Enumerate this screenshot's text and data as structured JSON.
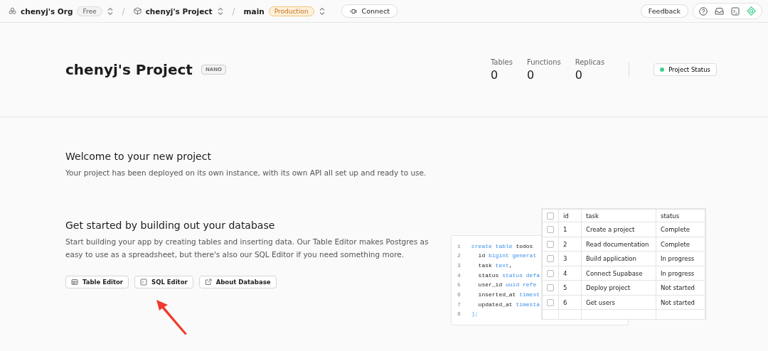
{
  "topbar": {
    "breadcrumbs": [
      {
        "kind": "org",
        "label": "chenyj's Org",
        "badge": {
          "text": "Free",
          "kind": "plan"
        }
      },
      {
        "kind": "project",
        "separator": "/",
        "label": "chenyj's Project"
      },
      {
        "kind": "branch",
        "separator": "/",
        "label": "main",
        "badge": {
          "text": "Production",
          "kind": "environment"
        }
      }
    ],
    "connect": "Connect",
    "feedback": "Feedback"
  },
  "header": {
    "title": "chenyj's Project",
    "tier": "NANO",
    "stats": [
      {
        "label": "Tables",
        "value": "0"
      },
      {
        "label": "Functions",
        "value": "0"
      },
      {
        "label": "Replicas",
        "value": "0"
      }
    ],
    "status": "Project Status"
  },
  "welcome": {
    "title": "Welcome to your new project",
    "text": "Your project has been deployed on its own instance, with its own API all set up and ready to use."
  },
  "database": {
    "title": "Get started by building out your database",
    "text": "Start building your app by creating tables and inserting data. Our Table Editor makes Postgres as easy to use as a spreadsheet, but there's also our SQL Editor if you need something more.",
    "buttons": [
      {
        "kind": "table",
        "label": "Table Editor"
      },
      {
        "kind": "sql",
        "label": "SQL Editor"
      },
      {
        "kind": "external",
        "label": "About Database"
      }
    ],
    "code": [
      {
        "number": "1",
        "indented": false,
        "tokens": [
          {
            "kind": "keyword",
            "text": "create table"
          },
          {
            "kind": "plain",
            "text": " todos"
          }
        ]
      },
      {
        "number": "2",
        "indented": true,
        "tokens": [
          {
            "kind": "plain",
            "text": "id "
          },
          {
            "kind": "keyword",
            "text": "bigint generat"
          }
        ]
      },
      {
        "number": "3",
        "indented": true,
        "tokens": [
          {
            "kind": "plain",
            "text": "task "
          },
          {
            "kind": "keyword",
            "text": "text"
          },
          {
            "kind": "plain",
            "text": ","
          }
        ]
      },
      {
        "number": "4",
        "indented": true,
        "tokens": [
          {
            "kind": "plain",
            "text": "status "
          },
          {
            "kind": "keyword",
            "text": "status defa"
          }
        ]
      },
      {
        "number": "5",
        "indented": true,
        "tokens": [
          {
            "kind": "plain",
            "text": "user_id "
          },
          {
            "kind": "keyword",
            "text": "uuid refe"
          }
        ]
      },
      {
        "number": "6",
        "indented": true,
        "tokens": [
          {
            "kind": "plain",
            "text": "inserted_at "
          },
          {
            "kind": "keyword",
            "text": "timest"
          }
        ]
      },
      {
        "number": "7",
        "indented": true,
        "tokens": [
          {
            "kind": "plain",
            "text": "updated_at "
          },
          {
            "kind": "keyword",
            "text": "timesta"
          }
        ]
      },
      {
        "number": "8",
        "indented": false,
        "tokens": [
          {
            "kind": "keyword",
            "text": ");"
          }
        ]
      }
    ],
    "table": {
      "columns": [
        "id",
        "task",
        "status"
      ],
      "header_checked": false,
      "rows": [
        {
          "checked": false,
          "cells": [
            "1",
            "Create a project",
            "Complete"
          ]
        },
        {
          "checked": false,
          "cells": [
            "2",
            "Read documentation",
            "Complete"
          ]
        },
        {
          "checked": false,
          "cells": [
            "3",
            "Build application",
            "In progress"
          ]
        },
        {
          "checked": false,
          "cells": [
            "4",
            "Connect Supabase",
            "In progress"
          ]
        },
        {
          "checked": false,
          "cells": [
            "5",
            "Deploy project",
            "Not started"
          ]
        },
        {
          "checked": false,
          "cells": [
            "6",
            "Get users",
            "Not started"
          ]
        }
      ]
    }
  }
}
